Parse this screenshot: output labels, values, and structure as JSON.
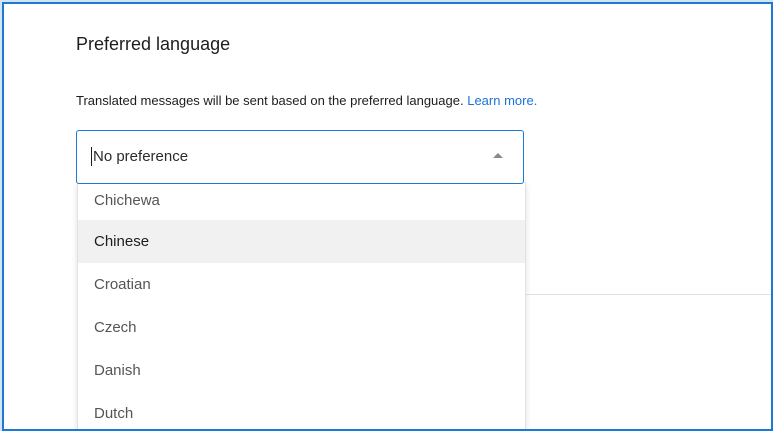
{
  "heading": "Preferred language",
  "description": {
    "text": "Translated messages will be sent based on the preferred language.",
    "link_label": "Learn more."
  },
  "language_select": {
    "value": "No preference",
    "expanded": true,
    "highlighted_option": "Chinese"
  },
  "dropdown": {
    "options": [
      {
        "label": "Chichewa"
      },
      {
        "label": "Chinese"
      },
      {
        "label": "Croatian"
      },
      {
        "label": "Czech"
      },
      {
        "label": "Danish"
      },
      {
        "label": "Dutch"
      }
    ]
  },
  "colors": {
    "accent": "#1c79d6",
    "link": "#1a73d9",
    "highlight_bg": "#f1f1f1"
  }
}
